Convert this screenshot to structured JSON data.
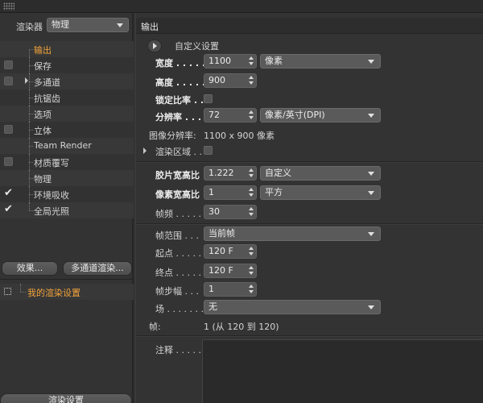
{
  "left_panel": {
    "renderer_label": "渲染器",
    "renderer_value": "物理",
    "tree_items": [
      {
        "label": "输出",
        "checkbox": "none",
        "active": true
      },
      {
        "label": "保存",
        "checkbox": "box"
      },
      {
        "label": "多通道",
        "checkbox": "box",
        "expandable": true
      },
      {
        "label": "抗锯齿",
        "checkbox": "none"
      },
      {
        "label": "选项",
        "checkbox": "none"
      },
      {
        "label": "立体",
        "checkbox": "box"
      },
      {
        "label": "Team Render",
        "checkbox": "none"
      },
      {
        "label": "材质覆写",
        "checkbox": "box"
      },
      {
        "label": "物理",
        "checkbox": "none"
      },
      {
        "label": "环境吸收",
        "checkbox": "checked"
      },
      {
        "label": "全局光照",
        "checkbox": "checked"
      }
    ],
    "effects_button": "效果...",
    "multipass_button": "多通道渲染...",
    "my_render_settings": "我的渲染设置",
    "render_settings_button": "渲染设置"
  },
  "right_panel": {
    "header": "输出",
    "preset_label": "自定义设置",
    "width_label": "宽度",
    "width_value": "1100",
    "width_unit": "像素",
    "height_label": "高度",
    "height_value": "900",
    "lock_ratio_label": "锁定比率",
    "resolution_label": "分辨率",
    "resolution_value": "72",
    "resolution_unit": "像素/英寸(DPI)",
    "image_resolution_label": "图像分辨率:",
    "image_resolution_value": "1100 x 900 像素",
    "render_region_label": "渲染区域",
    "film_aspect_label": "胶片宽高比",
    "film_aspect_value": "1.222",
    "film_aspect_preset": "自定义",
    "pixel_aspect_label": "像素宽高比",
    "pixel_aspect_value": "1",
    "pixel_aspect_preset": "平方",
    "frame_rate_label": "帧频",
    "frame_rate_value": "30",
    "frame_range_label": "帧范围",
    "frame_range_value": "当前帧",
    "start_label": "起点",
    "start_value": "120 F",
    "end_label": "终点",
    "end_value": "120 F",
    "frame_step_label": "帧步幅",
    "frame_step_value": "1",
    "field_label": "场",
    "field_value": "无",
    "frames_label": "帧:",
    "frames_value": "1 (从 120 到 120)",
    "notes_label": "注释"
  }
}
